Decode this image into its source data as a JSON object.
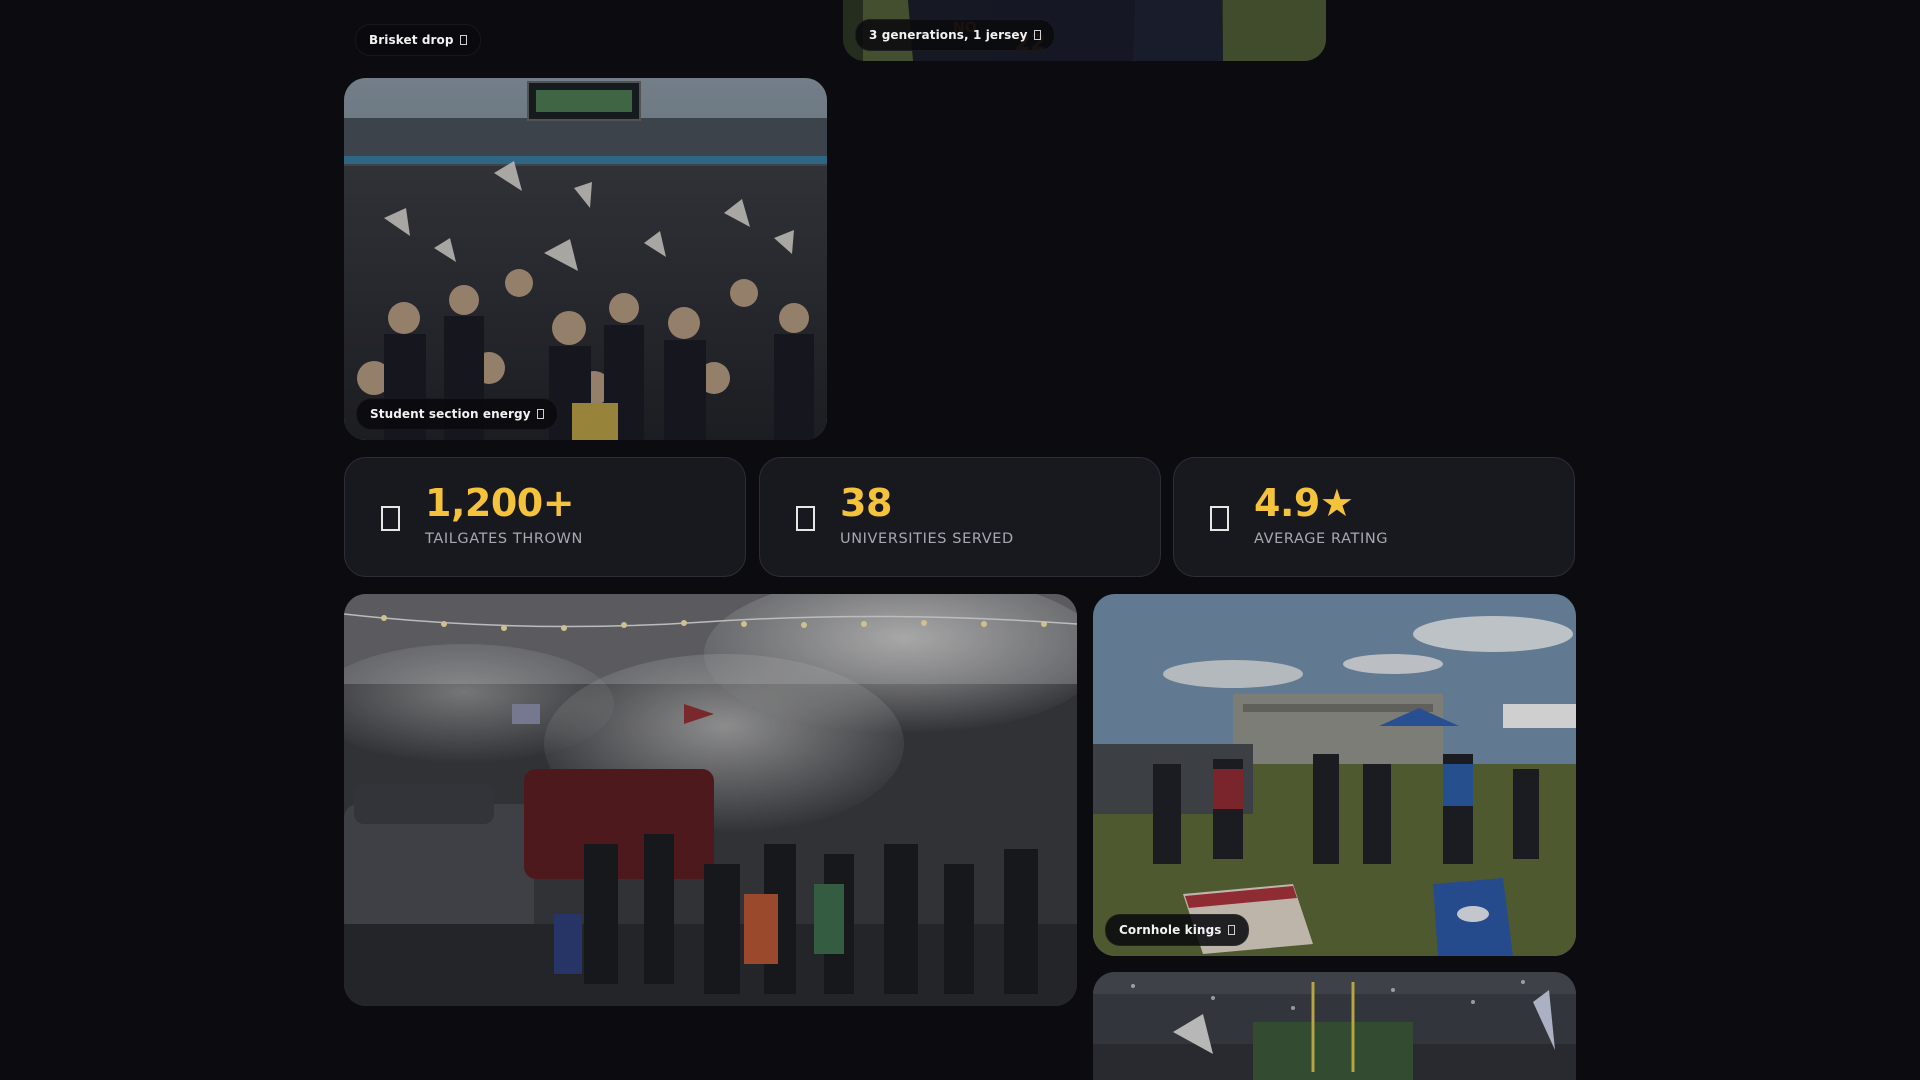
{
  "gallery": {
    "brisket_caption": "Brisket drop",
    "generations_caption": "3 generations, 1 jersey",
    "student_caption": "Student section energy",
    "cornhole_caption": "Cornhole kings"
  },
  "stats": [
    {
      "value": "1,200+",
      "label": "TAILGATES THROWN",
      "icon": "grill-icon"
    },
    {
      "value": "38",
      "label": "UNIVERSITIES SERVED",
      "icon": "university-icon"
    },
    {
      "value": "4.9★",
      "label": "AVERAGE RATING",
      "icon": "star-icon"
    }
  ],
  "colors": {
    "background": "#0b0b10",
    "card": "#18181f",
    "accent": "#f5c23c",
    "muted": "#a8a8b3"
  }
}
